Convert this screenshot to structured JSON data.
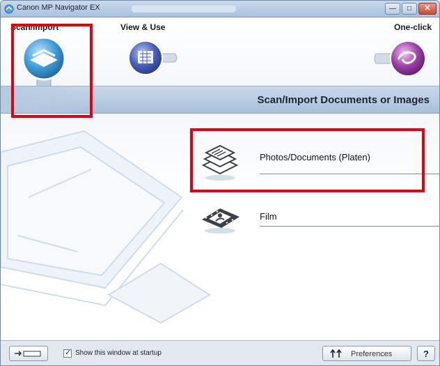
{
  "window": {
    "title": "Canon MP Navigator EX"
  },
  "modes": [
    {
      "label": "Scan/Import",
      "icon": "scanner-icon",
      "selected": true
    },
    {
      "label": "View & Use",
      "icon": "photo-grid-icon",
      "selected": false
    },
    {
      "label": "One-click",
      "icon": "swirl-icon",
      "selected": false
    }
  ],
  "header": {
    "title": "Scan/Import Documents or Images"
  },
  "options": [
    {
      "label": "Photos/Documents (Platen)",
      "icon": "documents-stack-icon"
    },
    {
      "label": "Film",
      "icon": "film-strip-icon"
    }
  ],
  "footer": {
    "startup_label": "Show this window at startup",
    "startup_checked": true,
    "preferences_label": "Preferences",
    "help_label": "?",
    "preferences_icon": "preferences-arrows-icon",
    "mode_switch_icon": "mode-switch-icon"
  },
  "colors": {
    "highlight": "#e3000f",
    "header_strip": "#b8cce2",
    "scan_orb": "#3d9ad8",
    "view_orb": "#4a5fb8",
    "oneclick_orb": "#9b3fa8"
  }
}
